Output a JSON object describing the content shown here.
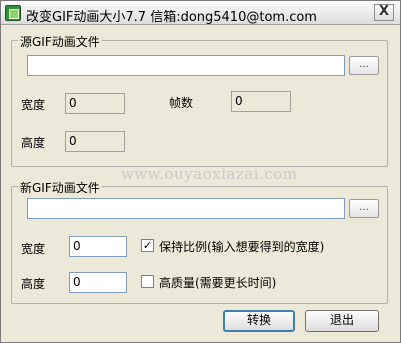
{
  "window": {
    "title": "改变GIF动画大小7.7  信箱:dong5410@tom.com",
    "close_label": "X"
  },
  "source": {
    "group_label": "源GIF动画文件",
    "path_value": "",
    "browse_label": "...",
    "width_label": "宽度",
    "width_value": "0",
    "frames_label": "帧数",
    "frames_value": "0",
    "height_label": "高度",
    "height_value": "0"
  },
  "watermark": "www.ouyaoxiazai.com",
  "target": {
    "group_label": "新GIF动画文件",
    "path_value": "",
    "browse_label": "...",
    "width_label": "宽度",
    "width_value": "0",
    "keep_ratio_label": "保持比例(输入想要得到的宽度)",
    "keep_ratio_checked": true,
    "height_label": "高度",
    "height_value": "0",
    "high_quality_label": "高质量(需要更长时间)",
    "high_quality_checked": false
  },
  "actions": {
    "convert_label": "转换",
    "exit_label": "退出"
  }
}
